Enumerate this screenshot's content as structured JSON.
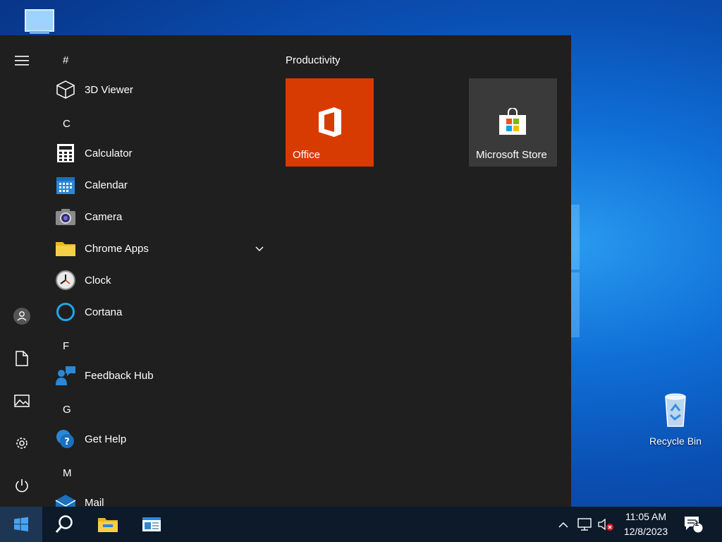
{
  "desktop": {
    "recycle_bin_label": "Recycle Bin"
  },
  "start_menu": {
    "sections": {
      "hash": "#",
      "c": "C",
      "f": "F",
      "g": "G",
      "m": "M"
    },
    "apps": {
      "viewer3d": "3D Viewer",
      "calculator": "Calculator",
      "calendar": "Calendar",
      "camera": "Camera",
      "chrome_apps": "Chrome Apps",
      "clock": "Clock",
      "cortana": "Cortana",
      "feedback_hub": "Feedback Hub",
      "get_help": "Get Help",
      "mail": "Mail"
    },
    "tiles_group": "Productivity",
    "tiles": {
      "office": "Office",
      "store": "Microsoft Store"
    }
  },
  "taskbar": {
    "time": "11:05 AM",
    "date": "12/8/2023",
    "notification_count": "1"
  },
  "colors": {
    "office_tile": "#d83b01",
    "store_tile": "#3a3a3a",
    "menu_bg": "#1f1f1f",
    "taskbar_bg": "#0c1a2a"
  }
}
